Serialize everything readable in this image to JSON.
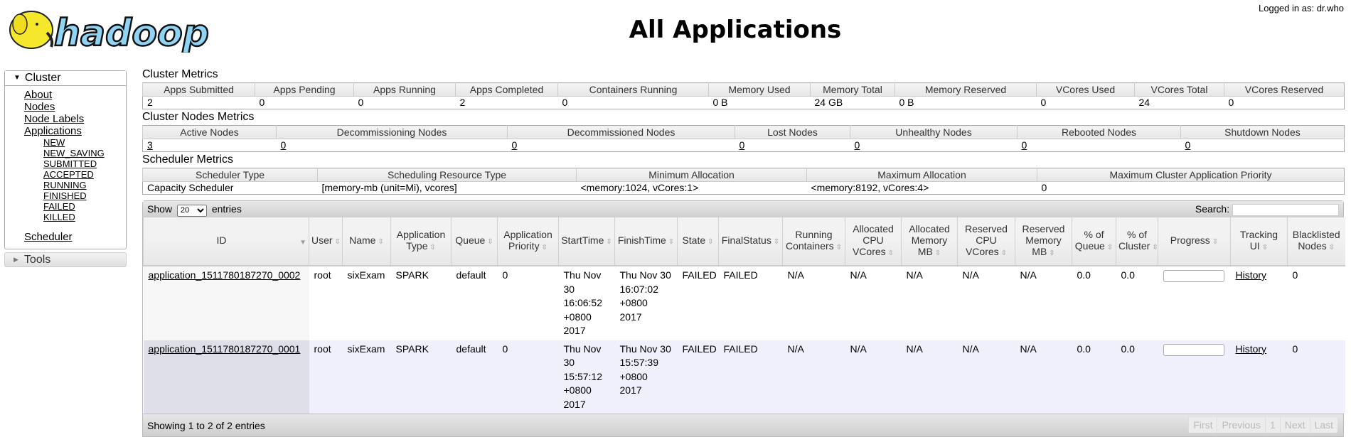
{
  "header": {
    "logo_text": "hadoop",
    "title": "All Applications",
    "logged_in": "Logged in as: dr.who"
  },
  "colors": {
    "logo_blue": "#8fd3f5",
    "logo_yellow": "#f5e82c",
    "even_row": "#eff0fc"
  },
  "nav": {
    "cluster_label": "Cluster",
    "links": [
      "About",
      "Nodes",
      "Node Labels",
      "Applications"
    ],
    "app_states": [
      "NEW",
      "NEW_SAVING",
      "SUBMITTED",
      "ACCEPTED",
      "RUNNING",
      "FINISHED",
      "FAILED",
      "KILLED"
    ],
    "scheduler": "Scheduler",
    "tools_label": "Tools"
  },
  "cluster_metrics": {
    "title": "Cluster Metrics",
    "headers": [
      "Apps Submitted",
      "Apps Pending",
      "Apps Running",
      "Apps Completed",
      "Containers Running",
      "Memory Used",
      "Memory Total",
      "Memory Reserved",
      "VCores Used",
      "VCores Total",
      "VCores Reserved"
    ],
    "values": [
      "2",
      "0",
      "0",
      "2",
      "0",
      "0 B",
      "24 GB",
      "0 B",
      "0",
      "24",
      "0"
    ]
  },
  "node_metrics": {
    "title": "Cluster Nodes Metrics",
    "headers": [
      "Active Nodes",
      "Decommissioning Nodes",
      "Decommissioned Nodes",
      "Lost Nodes",
      "Unhealthy Nodes",
      "Rebooted Nodes",
      "Shutdown Nodes"
    ],
    "values": [
      "3",
      "0",
      "0",
      "0",
      "0",
      "0",
      "0"
    ]
  },
  "scheduler_metrics": {
    "title": "Scheduler Metrics",
    "headers": [
      "Scheduler Type",
      "Scheduling Resource Type",
      "Minimum Allocation",
      "Maximum Allocation",
      "Maximum Cluster Application Priority"
    ],
    "values": [
      "Capacity Scheduler",
      "[memory-mb (unit=Mi), vcores]",
      "<memory:1024, vCores:1>",
      "<memory:8192, vCores:4>",
      "0"
    ]
  },
  "apps": {
    "show_label": "Show",
    "entries_label": "entries",
    "page_size": "20",
    "search_label": "Search:",
    "search_value": "",
    "headers": [
      "ID",
      "User",
      "Name",
      "Application Type",
      "Queue",
      "Application Priority",
      "StartTime",
      "FinishTime",
      "State",
      "FinalStatus",
      "Running Containers",
      "Allocated CPU VCores",
      "Allocated Memory MB",
      "Reserved CPU VCores",
      "Reserved Memory MB",
      "% of Queue",
      "% of Cluster",
      "Progress",
      "Tracking UI",
      "Blacklisted Nodes"
    ],
    "rows": [
      [
        "application_1511780187270_0002",
        "root",
        "sixExam",
        "SPARK",
        "default",
        "0",
        "Thu Nov 30 16:06:52 +0800 2017",
        "Thu Nov 30 16:07:02 +0800 2017",
        "FAILED",
        "FAILED",
        "N/A",
        "N/A",
        "N/A",
        "N/A",
        "N/A",
        "0.0",
        "0.0",
        "0",
        "History",
        "0"
      ],
      [
        "application_1511780187270_0001",
        "root",
        "sixExam",
        "SPARK",
        "default",
        "0",
        "Thu Nov 30 15:57:12 +0800 2017",
        "Thu Nov 30 15:57:39 +0800 2017",
        "FAILED",
        "FAILED",
        "N/A",
        "N/A",
        "N/A",
        "N/A",
        "N/A",
        "0.0",
        "0.0",
        "0",
        "History",
        "0"
      ]
    ],
    "info": "Showing 1 to 2 of 2 entries",
    "pager": [
      "First",
      "Previous",
      "1",
      "Next",
      "Last"
    ]
  }
}
